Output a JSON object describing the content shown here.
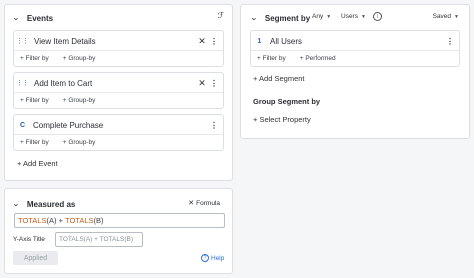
{
  "events_panel": {
    "title": "Events",
    "items": [
      {
        "badge": "",
        "name": "View Item Details",
        "filter": "+ Filter by",
        "group": "+ Group-by"
      },
      {
        "badge": "",
        "name": "Add Item to Cart",
        "filter": "+ Filter by",
        "group": "+ Group-by"
      },
      {
        "badge": "C",
        "name": "Complete Purchase",
        "filter": "+ Filter by",
        "group": "+ Group-by"
      }
    ],
    "add_event": "+ Add Event"
  },
  "segment_panel": {
    "title": "Segment by",
    "any_select": "Any",
    "users_select": "Users",
    "saved_select": "Saved",
    "segments": [
      {
        "badge": "1",
        "name": "All Users",
        "filter": "+ Filter by",
        "performed": "+ Performed"
      }
    ],
    "add_segment": "+ Add Segment",
    "group_heading": "Group Segment by",
    "select_property": "+ Select Property"
  },
  "measured_panel": {
    "title": "Measured as",
    "formula_label": "Formula",
    "formula_parts": [
      "TOTALS",
      "(A)",
      " + ",
      "TOTALS",
      "(B)"
    ],
    "axis_label": "Y-Axis Title",
    "axis_placeholder": "TOTALS(A) + TOTALS(B)",
    "applied_label": "Applied",
    "help_label": "Help"
  },
  "colors": {
    "formula_func": "#c0621f",
    "formula_text": "#3a4047",
    "link_blue": "#2e6fd8"
  }
}
